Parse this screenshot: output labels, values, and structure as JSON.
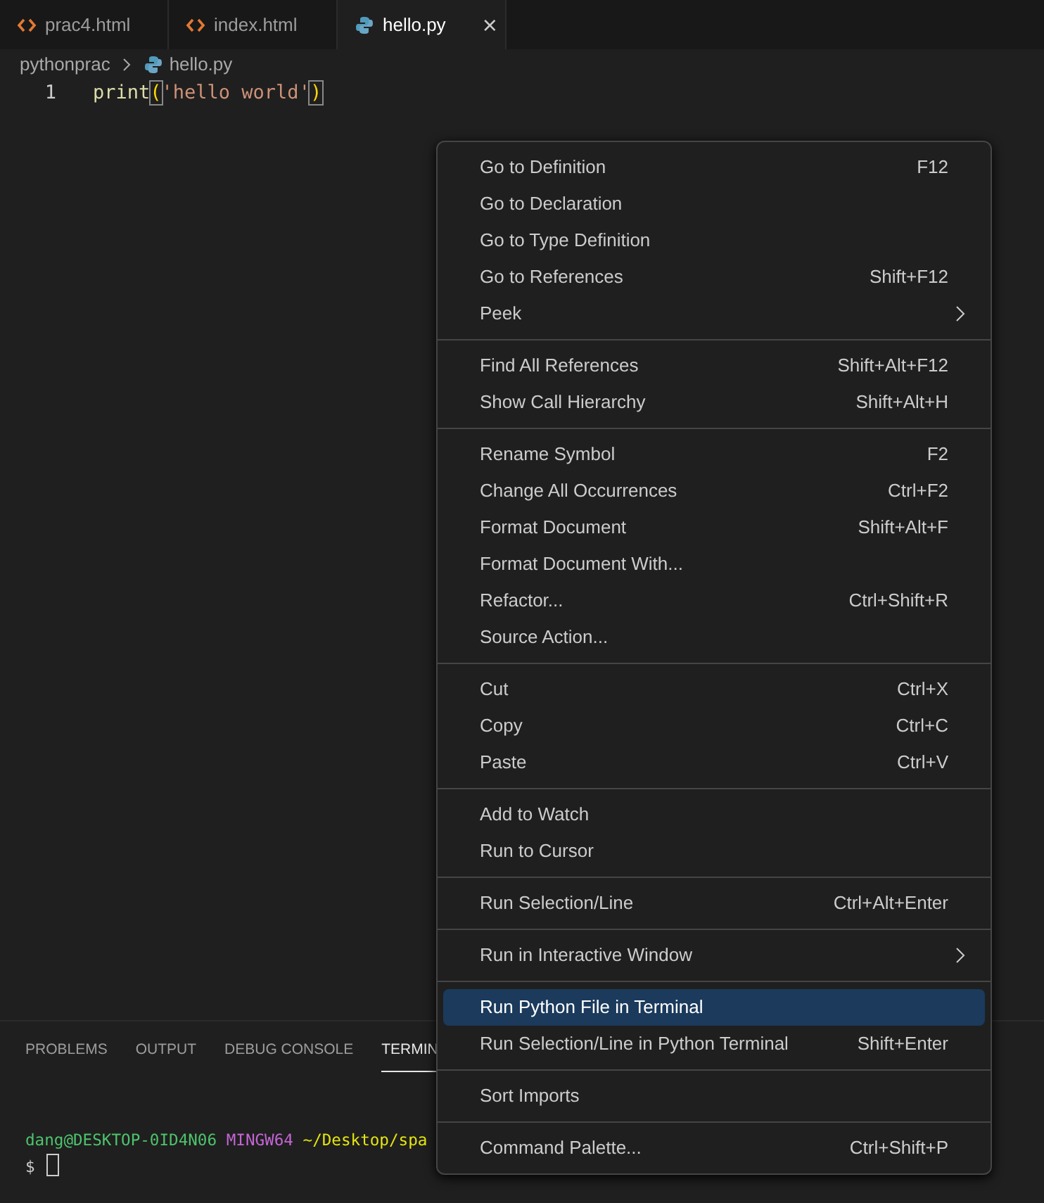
{
  "tabs": [
    {
      "label": "prac4.html",
      "kind": "html",
      "selected": false,
      "closable": false
    },
    {
      "label": "index.html",
      "kind": "html",
      "selected": false,
      "closable": false
    },
    {
      "label": "hello.py",
      "kind": "python",
      "selected": true,
      "closable": true
    }
  ],
  "close_glyph": "×",
  "breadcrumb": [
    {
      "label": "pythonprac",
      "kind": "folder"
    },
    {
      "label": "hello.py",
      "kind": "python"
    }
  ],
  "code": [
    {
      "line": "1",
      "tokens": [
        {
          "kind": "function",
          "text": "print"
        },
        {
          "kind": "bracket",
          "text": "("
        },
        {
          "kind": "string",
          "text": "'hello world'"
        },
        {
          "kind": "bracket",
          "text": ")"
        }
      ]
    }
  ],
  "panel": {
    "tabs": [
      {
        "label": "PROBLEMS",
        "selected": false
      },
      {
        "label": "OUTPUT",
        "selected": false
      },
      {
        "label": "DEBUG CONSOLE",
        "selected": false
      },
      {
        "label": "TERMIN",
        "selected": true
      }
    ],
    "terminal": [
      {
        "tokens": [
          {
            "kind": "user",
            "text": "dang@DESKTOP-0ID4N06"
          },
          {
            "kind": "system",
            "text": "MINGW64"
          },
          {
            "kind": "path",
            "text": "~/Desktop/spa"
          }
        ]
      },
      {
        "tokens": [
          {
            "kind": "prompt",
            "text": "$"
          },
          {
            "kind": "cursor"
          }
        ]
      }
    ]
  },
  "context_menu": [
    [
      {
        "label": "Go to Definition",
        "shortcut": "F12"
      },
      {
        "label": "Go to Declaration"
      },
      {
        "label": "Go to Type Definition"
      },
      {
        "label": "Go to References",
        "shortcut": "Shift+F12"
      },
      {
        "label": "Peek",
        "submenu": true
      }
    ],
    [
      {
        "label": "Find All References",
        "shortcut": "Shift+Alt+F12"
      },
      {
        "label": "Show Call Hierarchy",
        "shortcut": "Shift+Alt+H"
      }
    ],
    [
      {
        "label": "Rename Symbol",
        "shortcut": "F2"
      },
      {
        "label": "Change All Occurrences",
        "shortcut": "Ctrl+F2"
      },
      {
        "label": "Format Document",
        "shortcut": "Shift+Alt+F"
      },
      {
        "label": "Format Document With..."
      },
      {
        "label": "Refactor...",
        "shortcut": "Ctrl+Shift+R"
      },
      {
        "label": "Source Action..."
      }
    ],
    [
      {
        "label": "Cut",
        "shortcut": "Ctrl+X"
      },
      {
        "label": "Copy",
        "shortcut": "Ctrl+C"
      },
      {
        "label": "Paste",
        "shortcut": "Ctrl+V"
      }
    ],
    [
      {
        "label": "Add to Watch"
      },
      {
        "label": "Run to Cursor"
      }
    ],
    [
      {
        "label": "Run Selection/Line",
        "shortcut": "Ctrl+Alt+Enter"
      }
    ],
    [
      {
        "label": "Run in Interactive Window",
        "submenu": true
      }
    ],
    [
      {
        "label": "Run Python File in Terminal",
        "selected": true
      },
      {
        "label": "Run Selection/Line in Python Terminal",
        "shortcut": "Shift+Enter"
      }
    ],
    [
      {
        "label": "Sort Imports"
      }
    ],
    [
      {
        "label": "Command Palette...",
        "shortcut": "Ctrl+Shift+P"
      }
    ]
  ]
}
